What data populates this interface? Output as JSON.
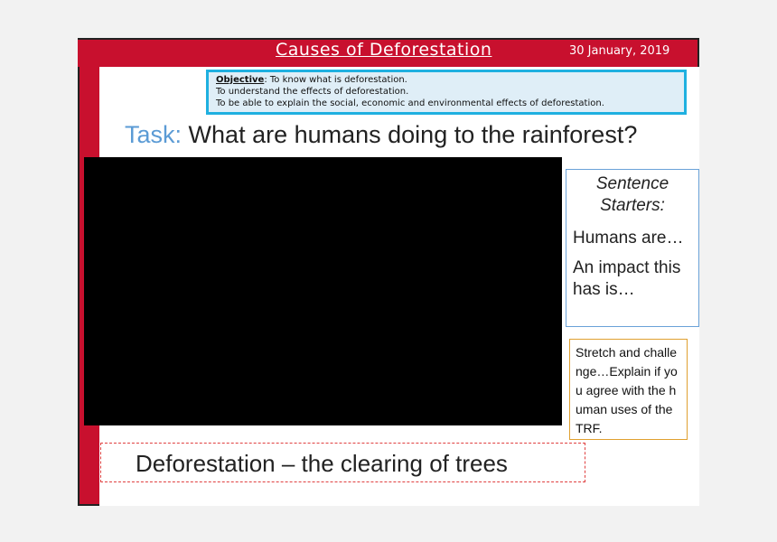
{
  "header": {
    "title": "Causes of Deforestation",
    "date": "30 January, 2019"
  },
  "objective": {
    "label": "Objective",
    "line1": ": To know what is deforestation.",
    "line2": "To understand the effects of deforestation.",
    "line3": "To be able to explain the social, economic and environmental effects of deforestation."
  },
  "task": {
    "prefix": "Task:",
    "question": "What are humans doing to the rainforest?"
  },
  "sentence_starters": {
    "heading": "Sentence Starters:",
    "line1": "Humans are…",
    "line2": "An impact this has is…"
  },
  "stretch": {
    "text": "Stretch and challenge…Explain if you agree with the human uses of the TRF."
  },
  "definition": {
    "text": "Deforestation – the clearing of trees"
  },
  "colors": {
    "accent_red": "#c8102e",
    "objective_border": "#1fb0e0",
    "task_blue": "#5b9bd5"
  }
}
